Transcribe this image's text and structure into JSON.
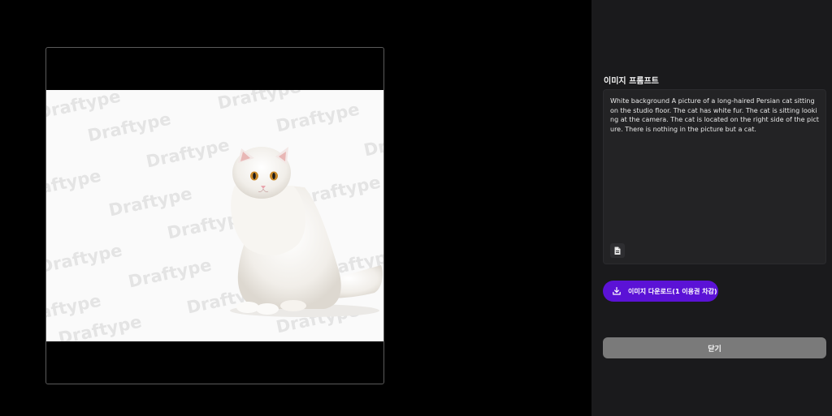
{
  "preview": {
    "watermark": "Draftype",
    "image_alt": "White long-haired Persian cat sitting on a white studio floor"
  },
  "panel": {
    "heading": "이미지 프롬프트",
    "prompt_text": "White background A picture of a long-haired Persian cat sitting on the studio floor. The cat has white fur. The cat is sitting looking at the camera. The cat is located on the right side of the picture. There is nothing in the picture but a cat.",
    "copy_icon": "document-copy-icon",
    "download_label": "이미지 다운로드(1 이용권 차감)",
    "download_icon": "download-icon",
    "close_label": "닫기"
  },
  "colors": {
    "accent": "#5b12d6",
    "panel_bg": "#1a1a1c",
    "close_bg": "#7a7a7a"
  }
}
